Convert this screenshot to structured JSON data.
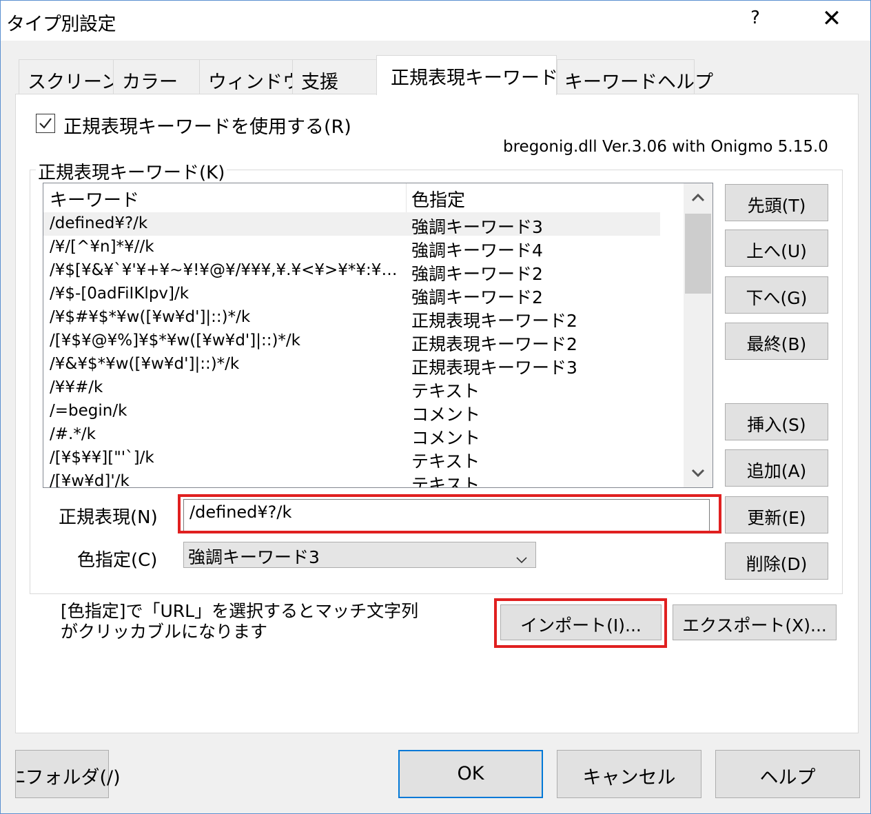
{
  "window": {
    "title": "タイプ別設定",
    "help_glyph": "?",
    "close_glyph": "✕"
  },
  "tabs": [
    {
      "label": "スクリーン"
    },
    {
      "label": "カラー"
    },
    {
      "label": "ウィンドウ"
    },
    {
      "label": "支援"
    },
    {
      "label": "正規表現キーワード"
    },
    {
      "label": "キーワードヘルプ"
    }
  ],
  "active_tab": "正規表現キーワード",
  "use_regex": {
    "label": "正規表現キーワードを使用する(R)",
    "checked": true
  },
  "version_text": "bregonig.dll Ver.3.06 with Onigmo 5.15.0",
  "group": {
    "legend": "正規表現キーワード(K)"
  },
  "list": {
    "columns": [
      "キーワード",
      "色指定"
    ],
    "rows": [
      {
        "keyword": "/defined¥?/k",
        "color": "強調キーワード3"
      },
      {
        "keyword": "/¥/[^¥n]*¥//k",
        "color": "強調キーワード4"
      },
      {
        "keyword": "/¥$[¥&¥`¥'¥+¥~¥!¥@¥/¥¥¥,¥.¥<¥>¥*¥:¥\"…",
        "color": "強調キーワード2"
      },
      {
        "keyword": "/¥$-[0adFiIKlpv]/k",
        "color": "強調キーワード2"
      },
      {
        "keyword": "/¥$#¥$*¥w([¥w¥d']|::)*/k",
        "color": "正規表現キーワード2"
      },
      {
        "keyword": "/[¥$¥@¥%]¥$*¥w([¥w¥d']|::)*/k",
        "color": "正規表現キーワード2"
      },
      {
        "keyword": "/¥&¥$*¥w([¥w¥d']|::)*/k",
        "color": "正規表現キーワード3"
      },
      {
        "keyword": "/¥¥#/k",
        "color": "テキスト"
      },
      {
        "keyword": "/=begin/k",
        "color": "コメント"
      },
      {
        "keyword": "/#.*/k",
        "color": "コメント"
      },
      {
        "keyword": "/[¥$¥¥][\"'`]/k",
        "color": "テキスト"
      },
      {
        "keyword": "/[¥w¥d]'/k",
        "color": "テキスト"
      }
    ],
    "selected_index": 0
  },
  "side_buttons": {
    "top": "先頭(T)",
    "up": "上へ(U)",
    "down": "下へ(G)",
    "last": "最終(B)",
    "insert": "挿入(S)",
    "add": "追加(A)",
    "update": "更新(E)",
    "delete": "削除(D)"
  },
  "regex_field": {
    "label": "正規表現(N)",
    "value": "/defined¥?/k"
  },
  "color_field": {
    "label": "色指定(C)",
    "value": "強調キーワード3"
  },
  "note": {
    "line1": "[色指定]で「URL」を選択するとマッチ文字列",
    "line2": "がクリッカブルになります"
  },
  "import_button": "インポート(I)...",
  "export_button": "エクスポート(X)...",
  "footer": {
    "folder": "ﾆフォルダ(/)",
    "ok": "OK",
    "cancel": "キャンセル",
    "help": "ヘルプ"
  },
  "colors": {
    "highlight_red": "#e02020",
    "window_border": "#5a8fd0"
  }
}
